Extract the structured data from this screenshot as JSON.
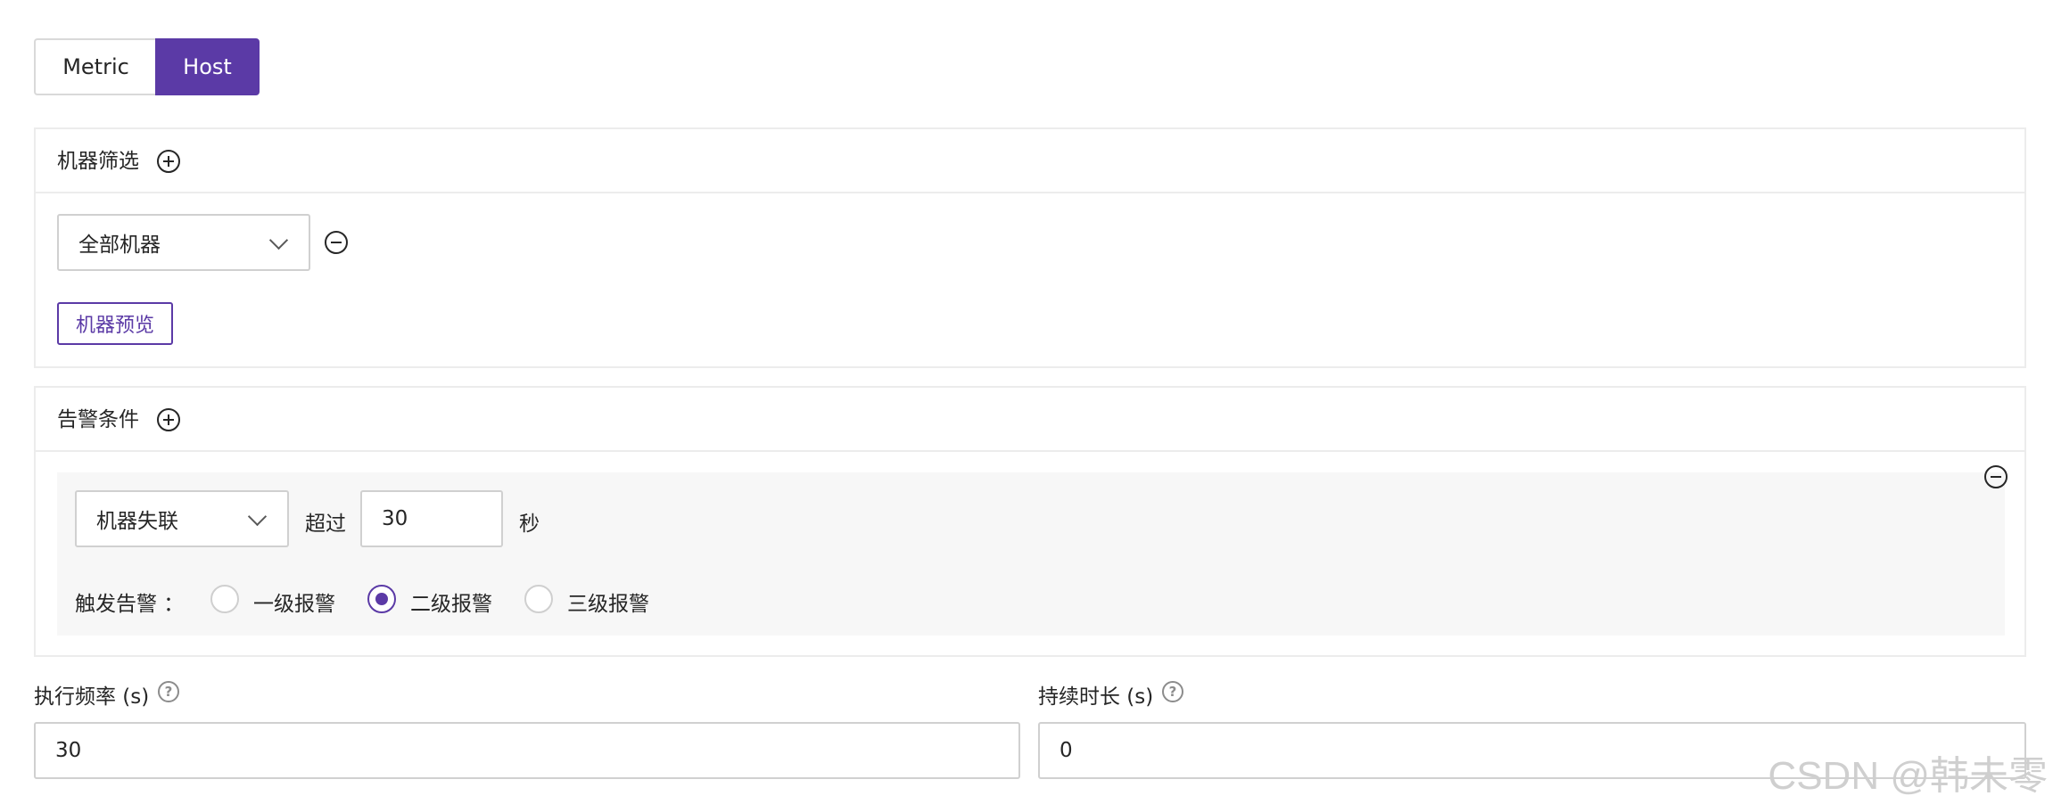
{
  "toggle": {
    "metric_label": "Metric",
    "host_label": "Host",
    "selected": "Host"
  },
  "machine_filter": {
    "title": "机器筛选",
    "add_icon": "plus-circle-icon",
    "select_value": "全部机器",
    "remove_icon": "minus-circle-icon",
    "preview_button": "机器预览"
  },
  "alarm_condition": {
    "title": "告警条件",
    "add_icon": "plus-circle-icon",
    "remove_icon": "minus-circle-icon",
    "condition_select": "机器失联",
    "exceed_label": "超过",
    "threshold_value": "30",
    "unit_label": "秒",
    "trigger_label": "触发告警 ：",
    "levels": [
      {
        "label": "一级报警",
        "checked": false
      },
      {
        "label": "二级报警",
        "checked": true
      },
      {
        "label": "三级报警",
        "checked": false
      }
    ]
  },
  "exec_frequency": {
    "label": "执行频率 (s)",
    "value": "30",
    "help_icon": "question-circle-icon"
  },
  "duration": {
    "label": "持续时长 (s)",
    "value": "0",
    "help_icon": "question-circle-icon"
  },
  "watermark": "CSDN @韩未零",
  "colors": {
    "accent": "#5b3aa6",
    "border": "#d0d0d0",
    "panel_bg": "#f7f7f7"
  }
}
